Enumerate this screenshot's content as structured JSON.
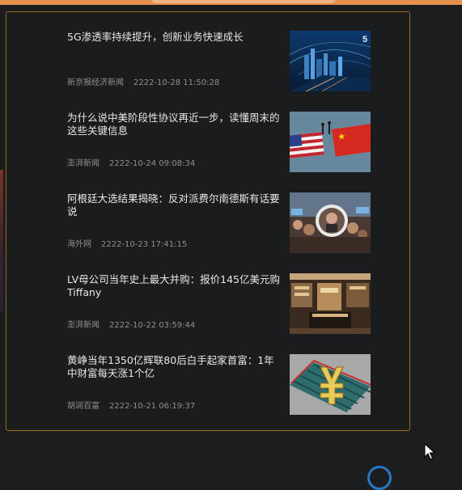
{
  "news": [
    {
      "title": "5G渗透率持续提升，创新业务快速成长",
      "source": "新京报经济新闻",
      "time": "2222-10-28 11:50:28",
      "thumb_text": "5"
    },
    {
      "title": "为什么说中美阶段性协议再近一步，读懂周末的这些关键信息",
      "source": "澎湃新闻",
      "time": "2222-10-24 09:08:34"
    },
    {
      "title": "阿根廷大选结果揭晓：反对派费尔南德斯有话要说",
      "source": "海外网",
      "time": "2222-10-23 17:41:15"
    },
    {
      "title": "LV母公司当年史上最大并购：报价145亿美元购Tiffany",
      "source": "澎湃新闻",
      "time": "2222-10-22 03:59:44"
    },
    {
      "title": "黄峥当年1350亿辉联80后白手起家首富：1年中财富每天涨1个亿",
      "source": "胡润百富",
      "time": "2222-10-21 06:19:37"
    }
  ]
}
